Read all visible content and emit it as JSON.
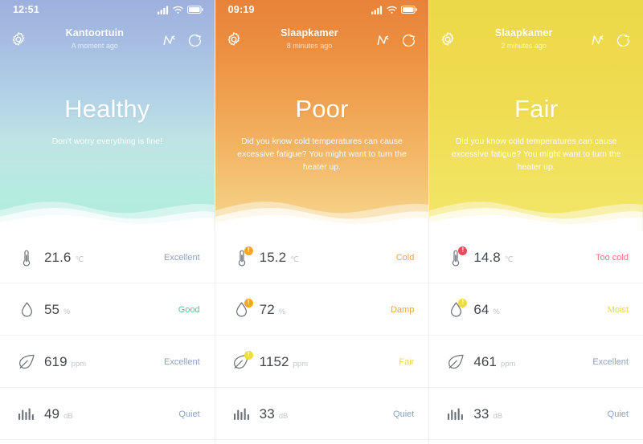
{
  "panels": [
    {
      "id": "panel-healthy",
      "statusbar": {
        "time": "12:51",
        "icons": [
          "signal-icon",
          "wifi-icon",
          "battery-icon"
        ],
        "visible": true
      },
      "header": {
        "room": "Kantoortuin",
        "updated": "A moment ago",
        "gear_icon": "gear-icon",
        "graph_icon": "graph-line-icon",
        "refresh_icon": "refresh-icon"
      },
      "hero": {
        "status": "Healthy",
        "tip": "Don't worry everything is fine!",
        "gradient_from": "#9eb0dd",
        "gradient_to": "#aeeedd"
      },
      "metrics": [
        {
          "icon": "thermometer-icon",
          "value": "21.6",
          "unit": "℃",
          "quality": "Excellent",
          "quality_color": "#8da2c0",
          "badge": null
        },
        {
          "icon": "droplet-icon",
          "value": "55",
          "unit": "%",
          "quality": "Good",
          "quality_color": "#5fbf8e",
          "badge": null
        },
        {
          "icon": "leaf-icon",
          "value": "619",
          "unit": "ppm",
          "quality": "Excellent",
          "quality_color": "#8da2c0",
          "badge": null
        },
        {
          "icon": "sound-bars-icon",
          "value": "49",
          "unit": "dB",
          "quality": "Quiet",
          "quality_color": "#8da2c0",
          "badge": null
        }
      ]
    },
    {
      "id": "panel-poor",
      "statusbar": {
        "time": "09:19",
        "icons": [
          "signal-icon",
          "wifi-icon",
          "battery-icon"
        ],
        "visible": true
      },
      "header": {
        "room": "Slaapkamer",
        "updated": "8 minutes ago",
        "gear_icon": "gear-icon",
        "graph_icon": "graph-line-icon",
        "refresh_icon": "refresh-icon"
      },
      "hero": {
        "status": "Poor",
        "tip": "Did you know cold temperatures can cause excessive fatigue? You might want to turn the heater up.",
        "gradient_from": "#e8823a",
        "gradient_to": "#f6d78f"
      },
      "metrics": [
        {
          "icon": "thermometer-icon",
          "value": "15.2",
          "unit": "℃",
          "quality": "Cold",
          "quality_color": "#f0a44a",
          "badge": {
            "symbol": "!",
            "color": "#f5a623"
          }
        },
        {
          "icon": "droplet-icon",
          "value": "72",
          "unit": "%",
          "quality": "Damp",
          "quality_color": "#f0a44a",
          "badge": {
            "symbol": "!",
            "color": "#f5a623"
          }
        },
        {
          "icon": "leaf-icon",
          "value": "1152",
          "unit": "ppm",
          "quality": "Fair",
          "quality_color": "#ecd84f",
          "badge": {
            "symbol": "!",
            "color": "#efdc3f"
          }
        },
        {
          "icon": "sound-bars-icon",
          "value": "33",
          "unit": "dB",
          "quality": "Quiet",
          "quality_color": "#8da2c0",
          "badge": null
        }
      ]
    },
    {
      "id": "panel-fair",
      "statusbar": {
        "time": "",
        "icons": [],
        "visible": false
      },
      "header": {
        "room": "Slaapkamer",
        "updated": "2 minutes ago",
        "gear_icon": "gear-icon",
        "graph_icon": "graph-line-icon",
        "refresh_icon": "refresh-icon"
      },
      "hero": {
        "status": "Fair",
        "tip": "Did you know cold temperatures can cause excessive fatigue? You might want to turn the heater up.",
        "gradient_from": "#ecd949",
        "gradient_to": "#f2e66a"
      },
      "metrics": [
        {
          "icon": "thermometer-icon",
          "value": "14.8",
          "unit": "℃",
          "quality": "Too cold",
          "quality_color": "#f4707f",
          "badge": {
            "symbol": "!",
            "color": "#ec4b5a"
          }
        },
        {
          "icon": "droplet-icon",
          "value": "64",
          "unit": "%",
          "quality": "Moist",
          "quality_color": "#eed64e",
          "badge": {
            "symbol": "!",
            "color": "#efdc3f"
          }
        },
        {
          "icon": "leaf-icon",
          "value": "461",
          "unit": "ppm",
          "quality": "Excellent",
          "quality_color": "#8da2c0",
          "badge": null
        },
        {
          "icon": "sound-bars-icon",
          "value": "33",
          "unit": "dB",
          "quality": "Quiet",
          "quality_color": "#8da2c0",
          "badge": null
        }
      ]
    }
  ]
}
